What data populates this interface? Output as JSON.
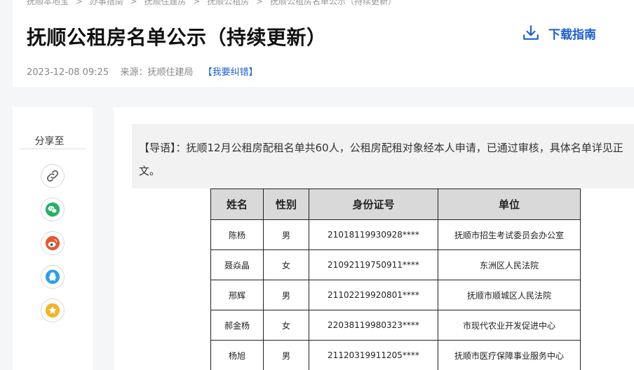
{
  "breadcrumb": [
    "抚顺本地宝",
    ">",
    "办事指南",
    ">",
    "抚顺住建房",
    ">",
    "抚顺公租房",
    ">",
    "抚顺公租房名单公示（持续更新）"
  ],
  "article": {
    "title": "抚顺公租房名单公示（持续更新）",
    "date": "2023-12-08 09:25",
    "source_label": "来源：",
    "source": "抚顺住建局",
    "correction_link": "【我要纠错】",
    "download_label": "下载指南"
  },
  "share": {
    "title": "分享至",
    "icons": [
      "link-icon",
      "wechat-icon",
      "weibo-icon",
      "qq-icon",
      "qzone-icon"
    ]
  },
  "intro": {
    "label": "【导语】：",
    "text": "抚顺12月公租房配租名单共60人，公租房配租对象经本人申请，已通过审核，具体名单详见正文。"
  },
  "table": {
    "headers": [
      "姓名",
      "性别",
      "身份证号",
      "单位"
    ],
    "rows": [
      [
        "陈杨",
        "男",
        "21018119930928****",
        "抚顺市招生考试委员会办公室"
      ],
      [
        "聂焱晶",
        "女",
        "21092119750911****",
        "东洲区人民法院"
      ],
      [
        "邢辉",
        "男",
        "21102219920801****",
        "抚顺市顺城区人民法院"
      ],
      [
        "郝金杨",
        "女",
        "22038119980323****",
        "市现代农业开发促进中心"
      ],
      [
        "杨旭",
        "男",
        "21120319911205****",
        "抚顺市医疗保障事业服务中心"
      ]
    ]
  },
  "colors": {
    "accent": "#1a5fd6",
    "wechat": "#2aae67",
    "weibo": "#e6572e",
    "qq": "#2a9ff0",
    "qzone": "#f5b324"
  }
}
